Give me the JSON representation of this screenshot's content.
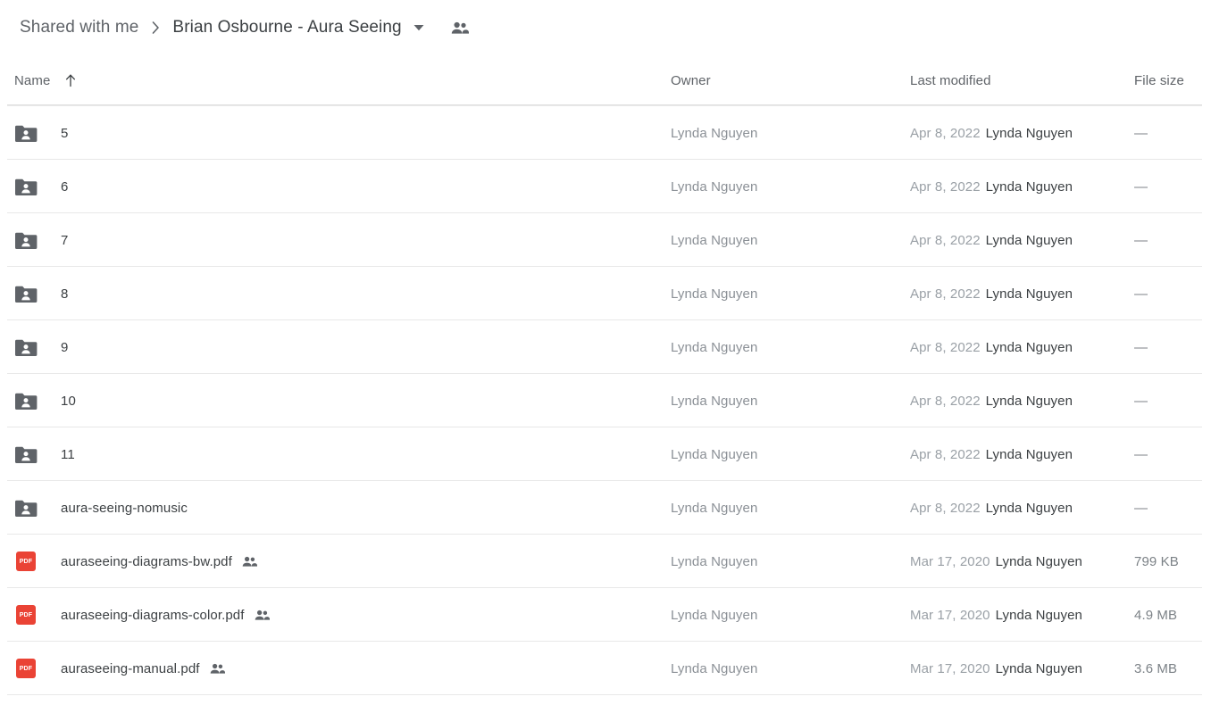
{
  "breadcrumb": {
    "parent": "Shared with me",
    "separator": "›",
    "current": "Brian Osbourne - Aura Seeing",
    "caret_icon": "chevron-down-icon",
    "people_icon": "people-shared-icon"
  },
  "columns": {
    "name": "Name",
    "owner": "Owner",
    "last_modified": "Last modified",
    "file_size": "File size",
    "sort_icon": "arrow-up-icon"
  },
  "colors": {
    "pdf_badge": "#ea4335",
    "folder_icon": "#5f6368",
    "text_primary": "#3c4043",
    "text_secondary": "#5f6368",
    "text_muted": "#9aa0a6",
    "divider": "#e8e8e8"
  },
  "rows": [
    {
      "icon": "shared-folder-icon",
      "type": "folder",
      "name": "5",
      "shared": false,
      "owner": "Lynda Nguyen",
      "modified_date": "Apr 8, 2022",
      "modified_by": "Lynda Nguyen",
      "size": "—"
    },
    {
      "icon": "shared-folder-icon",
      "type": "folder",
      "name": "6",
      "shared": false,
      "owner": "Lynda Nguyen",
      "modified_date": "Apr 8, 2022",
      "modified_by": "Lynda Nguyen",
      "size": "—"
    },
    {
      "icon": "shared-folder-icon",
      "type": "folder",
      "name": "7",
      "shared": false,
      "owner": "Lynda Nguyen",
      "modified_date": "Apr 8, 2022",
      "modified_by": "Lynda Nguyen",
      "size": "—"
    },
    {
      "icon": "shared-folder-icon",
      "type": "folder",
      "name": "8",
      "shared": false,
      "owner": "Lynda Nguyen",
      "modified_date": "Apr 8, 2022",
      "modified_by": "Lynda Nguyen",
      "size": "—"
    },
    {
      "icon": "shared-folder-icon",
      "type": "folder",
      "name": "9",
      "shared": false,
      "owner": "Lynda Nguyen",
      "modified_date": "Apr 8, 2022",
      "modified_by": "Lynda Nguyen",
      "size": "—"
    },
    {
      "icon": "shared-folder-icon",
      "type": "folder",
      "name": "10",
      "shared": false,
      "owner": "Lynda Nguyen",
      "modified_date": "Apr 8, 2022",
      "modified_by": "Lynda Nguyen",
      "size": "—"
    },
    {
      "icon": "shared-folder-icon",
      "type": "folder",
      "name": "11",
      "shared": false,
      "owner": "Lynda Nguyen",
      "modified_date": "Apr 8, 2022",
      "modified_by": "Lynda Nguyen",
      "size": "—"
    },
    {
      "icon": "shared-folder-icon",
      "type": "folder",
      "name": "aura-seeing-nomusic",
      "shared": false,
      "owner": "Lynda Nguyen",
      "modified_date": "Apr 8, 2022",
      "modified_by": "Lynda Nguyen",
      "size": "—"
    },
    {
      "icon": "pdf-file-icon",
      "type": "pdf",
      "name": "auraseeing-diagrams-bw.pdf",
      "shared": true,
      "owner": "Lynda Nguyen",
      "modified_date": "Mar 17, 2020",
      "modified_by": "Lynda Nguyen",
      "size": "799 KB"
    },
    {
      "icon": "pdf-file-icon",
      "type": "pdf",
      "name": "auraseeing-diagrams-color.pdf",
      "shared": true,
      "owner": "Lynda Nguyen",
      "modified_date": "Mar 17, 2020",
      "modified_by": "Lynda Nguyen",
      "size": "4.9 MB"
    },
    {
      "icon": "pdf-file-icon",
      "type": "pdf",
      "name": "auraseeing-manual.pdf",
      "shared": true,
      "owner": "Lynda Nguyen",
      "modified_date": "Mar 17, 2020",
      "modified_by": "Lynda Nguyen",
      "size": "3.6 MB"
    }
  ],
  "pdf_badge_label": "PDF"
}
